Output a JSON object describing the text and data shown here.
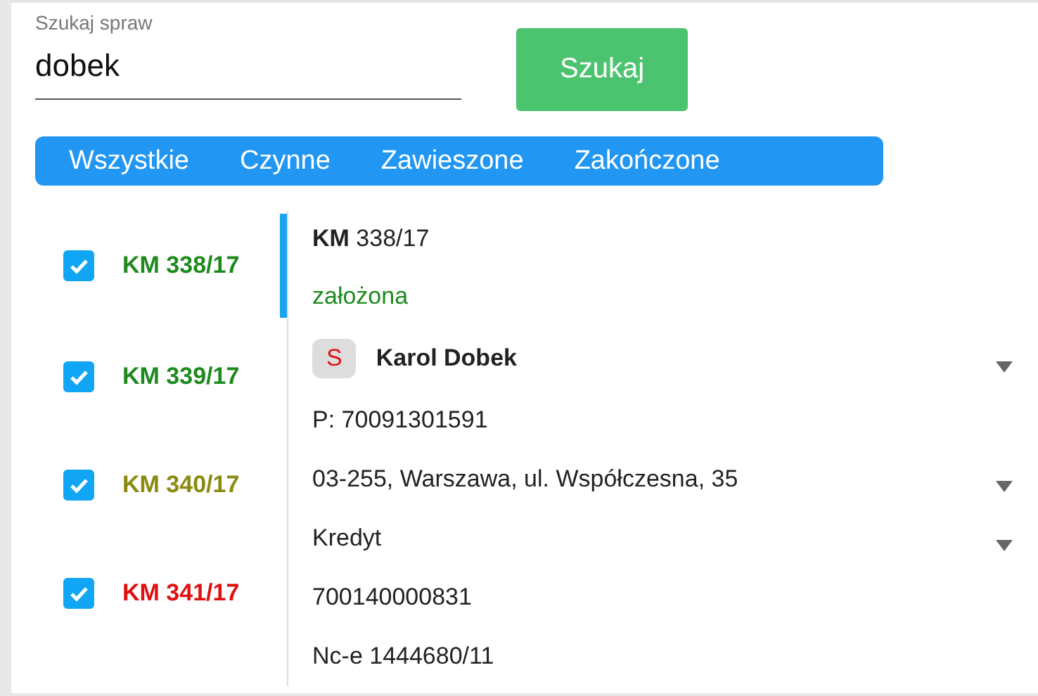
{
  "search": {
    "label": "Szukaj spraw",
    "value": "dobek",
    "button": "Szukaj"
  },
  "filters": [
    "Wszystkie",
    "Czynne",
    "Zawieszone",
    "Zakończone"
  ],
  "cases": [
    {
      "number": "KM 338/17",
      "checked": true,
      "selected": true,
      "color": "#1e8a1e"
    },
    {
      "number": "KM 339/17",
      "checked": true,
      "selected": false,
      "color": "#1e8a1e"
    },
    {
      "number": "KM 340/17",
      "checked": true,
      "selected": false,
      "color": "#8a8a10"
    },
    {
      "number": "KM 341/17",
      "checked": true,
      "selected": false,
      "color": "#e01010"
    }
  ],
  "detail": {
    "title": "**KM** 338/17",
    "status": "założona",
    "party": {
      "badge": "S",
      "name": "Karol Dobek",
      "expandable": true
    },
    "lines": [
      {
        "text": "P: 70091301591",
        "expandable": false
      },
      {
        "text": "03-255, Warszawa, ul. Współczesna, 35",
        "expandable": true
      },
      {
        "text": "Kredyt",
        "expandable": true
      },
      {
        "text": "700140000831",
        "expandable": false
      },
      {
        "text": "Nc-e 1444680/11",
        "expandable": false
      }
    ]
  }
}
